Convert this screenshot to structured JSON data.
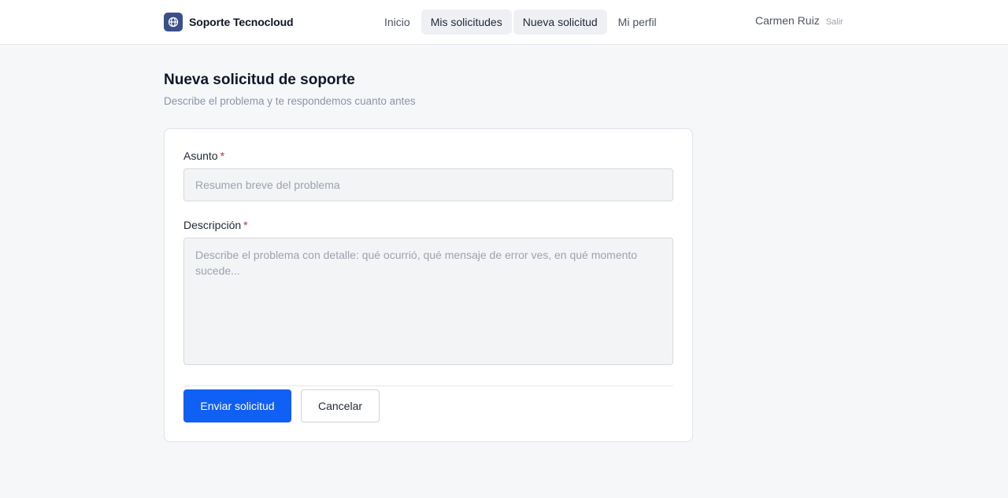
{
  "header": {
    "brand_name": "Soporte Tecnocloud",
    "brand_icon": "globe-icon",
    "nav": [
      {
        "label": "Inicio",
        "active": false
      },
      {
        "label": "Mis solicitudes",
        "active": true
      },
      {
        "label": "Nueva solicitud",
        "active": true
      },
      {
        "label": "Mi perfil",
        "active": false
      }
    ],
    "user_name": "Carmen Ruiz",
    "logout_label": "Salir"
  },
  "page": {
    "title": "Nueva solicitud de soporte",
    "subtitle": "Describe el problema y te respondemos cuanto antes"
  },
  "form": {
    "subject": {
      "label": "Asunto",
      "required_mark": "*",
      "value": "",
      "placeholder": "Resumen breve del problema"
    },
    "description": {
      "label": "Descripción",
      "required_mark": "*",
      "value": "",
      "placeholder": "Describe el problema con detalle: qué ocurrió, qué mensaje de error ves, en qué momento sucede..."
    },
    "submit_label": "Enviar solicitud",
    "cancel_label": "Cancelar"
  },
  "colors": {
    "primary": "#1160f5",
    "brand_logo": "#3b4f8a",
    "required": "#dc2626",
    "background": "#f6f7f9"
  }
}
